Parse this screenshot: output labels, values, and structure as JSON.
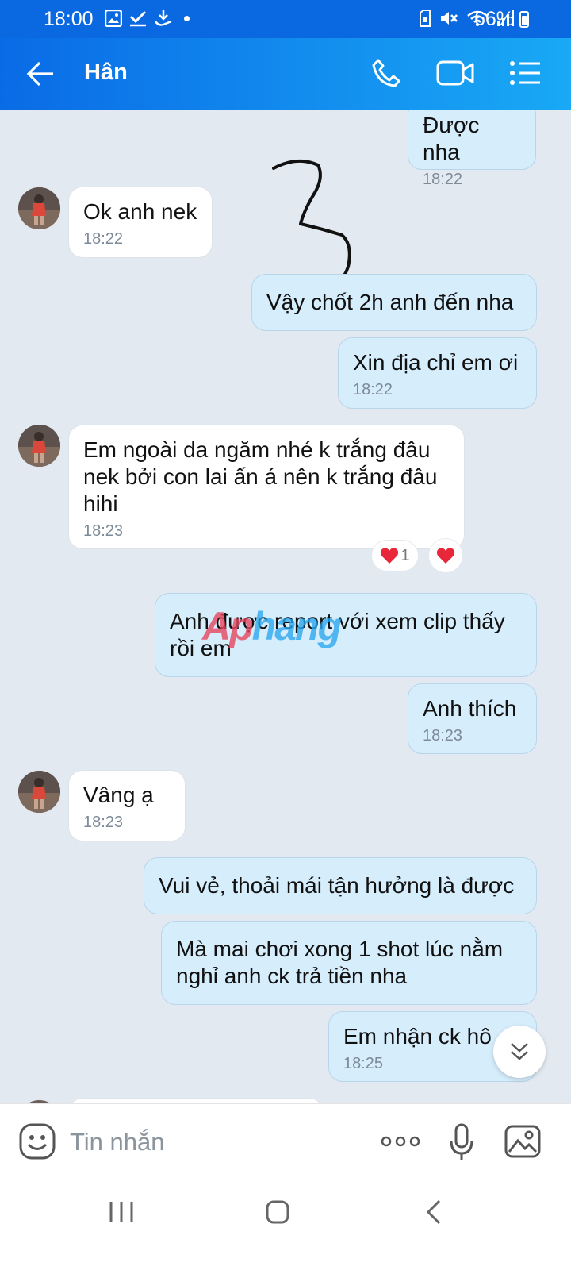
{
  "status_bar": {
    "time": "18:00",
    "battery": "66%",
    "icons": [
      "gallery-icon",
      "check-icon",
      "download-icon",
      "dot-icon",
      "sim-icon",
      "mute-icon",
      "wifi-icon",
      "signal-icon",
      "battery-icon"
    ]
  },
  "header": {
    "contact_name": "Hân",
    "actions": [
      "back-arrow-icon",
      "phone-icon",
      "video-call-icon",
      "menu-list-icon"
    ]
  },
  "messages": [
    {
      "direction": "out",
      "text": "Được nha",
      "time": "18:22"
    },
    {
      "direction": "in",
      "text": "Ok anh nek",
      "time": "18:22"
    },
    {
      "direction": "out",
      "text": "Vậy chốt 2h anh đến nha",
      "time": ""
    },
    {
      "direction": "out",
      "text": "Xin địa chỉ em ơi",
      "time": "18:22"
    },
    {
      "direction": "in",
      "text": "Em ngoài da ngăm nhé k trắng đâu nek bởi con lai ấn á nên k trắng đâu hihi",
      "time": "18:23",
      "reactions": {
        "heart_count": "1"
      }
    },
    {
      "direction": "out",
      "text": "Anh được report với xem clip thấy rồi em",
      "time": ""
    },
    {
      "direction": "out",
      "text": "Anh thích",
      "time": "18:23"
    },
    {
      "direction": "in",
      "text": "Vâng ạ",
      "time": "18:23"
    },
    {
      "direction": "out",
      "text": "Vui vẻ, thoải mái tận hưởng là được",
      "time": ""
    },
    {
      "direction": "out",
      "text": "Mà mai chơi xong 1 shot lúc nằm nghỉ anh ck trả tiền nha",
      "time": ""
    },
    {
      "direction": "out",
      "text": "Em nhận ck hô",
      "time": "18:25"
    }
  ],
  "watermark": {
    "part1": "Ap",
    "part2": "hang"
  },
  "composer": {
    "placeholder": "Tin nhắn"
  },
  "colors": {
    "header_start": "#0a6be6",
    "header_end": "#19a9f5",
    "outgoing_bubble": "#d6edfc",
    "incoming_bubble": "#ffffff",
    "chat_background": "#e2e9f1",
    "heart": "#e8283a"
  }
}
